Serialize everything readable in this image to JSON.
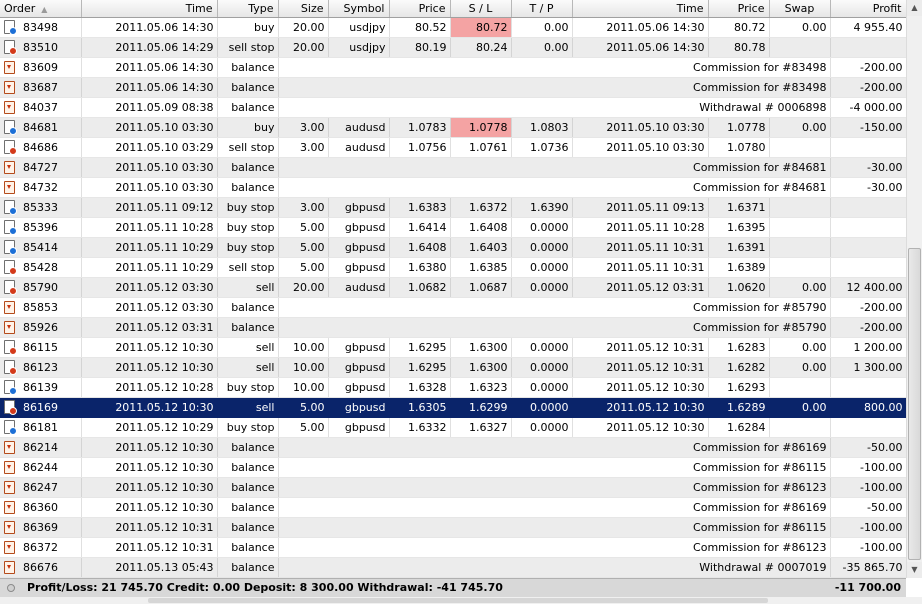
{
  "columns": {
    "order": "Order",
    "time": "Time",
    "type": "Type",
    "size": "Size",
    "symbol": "Symbol",
    "price": "Price",
    "sl": "S / L",
    "tp": "T / P",
    "close_time": "Time",
    "close_price": "Price",
    "swap": "Swap",
    "profit": "Profit"
  },
  "colors": {
    "selected_row": "#0a246a",
    "sl_highlight": "#f4a3a3",
    "buy_dot": "#1c6fd6",
    "sell_dot": "#d33a1a"
  },
  "rows": [
    {
      "order": "83498",
      "time": "2011.05.06 14:30",
      "type": "buy",
      "size": "20.00",
      "symbol": "usdjpy",
      "price": "80.52",
      "sl": "80.72",
      "tp": "0.00",
      "close_time": "2011.05.06 14:30",
      "close_price": "80.72",
      "swap": "0.00",
      "profit": "4 955.40",
      "icon": "buy-order-icon",
      "sl_hl": true
    },
    {
      "order": "83510",
      "time": "2011.05.06 14:29",
      "type": "sell stop",
      "size": "20.00",
      "symbol": "usdjpy",
      "price": "80.19",
      "sl": "80.24",
      "tp": "0.00",
      "close_time": "2011.05.06 14:30",
      "close_price": "80.78",
      "swap": "",
      "profit": "",
      "icon": "sell-order-icon"
    },
    {
      "order": "83609",
      "time": "2011.05.06 14:30",
      "type": "balance",
      "comment": "Commission for #83498",
      "profit": "-200.00",
      "icon": "balance-icon"
    },
    {
      "order": "83687",
      "time": "2011.05.06 14:30",
      "type": "balance",
      "comment": "Commission for #83498",
      "profit": "-200.00",
      "icon": "balance-icon"
    },
    {
      "order": "84037",
      "time": "2011.05.09 08:38",
      "type": "balance",
      "comment": "Withdrawal # 0006898",
      "profit": "-4 000.00",
      "icon": "balance-icon"
    },
    {
      "order": "84681",
      "time": "2011.05.10 03:30",
      "type": "buy",
      "size": "3.00",
      "symbol": "audusd",
      "price": "1.0783",
      "sl": "1.0778",
      "tp": "1.0803",
      "close_time": "2011.05.10 03:30",
      "close_price": "1.0778",
      "swap": "0.00",
      "profit": "-150.00",
      "icon": "buy-order-icon",
      "sl_hl": true
    },
    {
      "order": "84686",
      "time": "2011.05.10 03:29",
      "type": "sell stop",
      "size": "3.00",
      "symbol": "audusd",
      "price": "1.0756",
      "sl": "1.0761",
      "tp": "1.0736",
      "close_time": "2011.05.10 03:30",
      "close_price": "1.0780",
      "swap": "",
      "profit": "",
      "icon": "sell-order-icon"
    },
    {
      "order": "84727",
      "time": "2011.05.10 03:30",
      "type": "balance",
      "comment": "Commission for #84681",
      "profit": "-30.00",
      "icon": "balance-icon"
    },
    {
      "order": "84732",
      "time": "2011.05.10 03:30",
      "type": "balance",
      "comment": "Commission for #84681",
      "profit": "-30.00",
      "icon": "balance-icon"
    },
    {
      "order": "85333",
      "time": "2011.05.11 09:12",
      "type": "buy stop",
      "size": "3.00",
      "symbol": "gbpusd",
      "price": "1.6383",
      "sl": "1.6372",
      "tp": "1.6390",
      "close_time": "2011.05.11 09:13",
      "close_price": "1.6371",
      "swap": "",
      "profit": "",
      "icon": "buy-order-icon"
    },
    {
      "order": "85396",
      "time": "2011.05.11 10:28",
      "type": "buy stop",
      "size": "5.00",
      "symbol": "gbpusd",
      "price": "1.6414",
      "sl": "1.6408",
      "tp": "0.0000",
      "close_time": "2011.05.11 10:28",
      "close_price": "1.6395",
      "swap": "",
      "profit": "",
      "icon": "buy-order-icon"
    },
    {
      "order": "85414",
      "time": "2011.05.11 10:29",
      "type": "buy stop",
      "size": "5.00",
      "symbol": "gbpusd",
      "price": "1.6408",
      "sl": "1.6403",
      "tp": "0.0000",
      "close_time": "2011.05.11 10:31",
      "close_price": "1.6391",
      "swap": "",
      "profit": "",
      "icon": "buy-order-icon"
    },
    {
      "order": "85428",
      "time": "2011.05.11 10:29",
      "type": "sell stop",
      "size": "5.00",
      "symbol": "gbpusd",
      "price": "1.6380",
      "sl": "1.6385",
      "tp": "0.0000",
      "close_time": "2011.05.11 10:31",
      "close_price": "1.6389",
      "swap": "",
      "profit": "",
      "icon": "sell-order-icon"
    },
    {
      "order": "85790",
      "time": "2011.05.12 03:30",
      "type": "sell",
      "size": "20.00",
      "symbol": "audusd",
      "price": "1.0682",
      "sl": "1.0687",
      "tp": "0.0000",
      "close_time": "2011.05.12 03:31",
      "close_price": "1.0620",
      "swap": "0.00",
      "profit": "12 400.00",
      "icon": "sell-order-icon"
    },
    {
      "order": "85853",
      "time": "2011.05.12 03:30",
      "type": "balance",
      "comment": "Commission for #85790",
      "profit": "-200.00",
      "icon": "balance-icon"
    },
    {
      "order": "85926",
      "time": "2011.05.12 03:31",
      "type": "balance",
      "comment": "Commission for #85790",
      "profit": "-200.00",
      "icon": "balance-icon"
    },
    {
      "order": "86115",
      "time": "2011.05.12 10:30",
      "type": "sell",
      "size": "10.00",
      "symbol": "gbpusd",
      "price": "1.6295",
      "sl": "1.6300",
      "tp": "0.0000",
      "close_time": "2011.05.12 10:31",
      "close_price": "1.6283",
      "swap": "0.00",
      "profit": "1 200.00",
      "icon": "sell-order-icon"
    },
    {
      "order": "86123",
      "time": "2011.05.12 10:30",
      "type": "sell",
      "size": "10.00",
      "symbol": "gbpusd",
      "price": "1.6295",
      "sl": "1.6300",
      "tp": "0.0000",
      "close_time": "2011.05.12 10:31",
      "close_price": "1.6282",
      "swap": "0.00",
      "profit": "1 300.00",
      "icon": "sell-order-icon"
    },
    {
      "order": "86139",
      "time": "2011.05.12 10:28",
      "type": "buy stop",
      "size": "10.00",
      "symbol": "gbpusd",
      "price": "1.6328",
      "sl": "1.6323",
      "tp": "0.0000",
      "close_time": "2011.05.12 10:30",
      "close_price": "1.6293",
      "swap": "",
      "profit": "",
      "icon": "buy-order-icon"
    },
    {
      "order": "86169",
      "time": "2011.05.12 10:30",
      "type": "sell",
      "size": "5.00",
      "symbol": "gbpusd",
      "price": "1.6305",
      "sl": "1.6299",
      "tp": "0.0000",
      "close_time": "2011.05.12 10:30",
      "close_price": "1.6289",
      "swap": "0.00",
      "profit": "800.00",
      "icon": "sell-order-icon",
      "selected": true
    },
    {
      "order": "86181",
      "time": "2011.05.12 10:29",
      "type": "buy stop",
      "size": "5.00",
      "symbol": "gbpusd",
      "price": "1.6332",
      "sl": "1.6327",
      "tp": "0.0000",
      "close_time": "2011.05.12 10:30",
      "close_price": "1.6284",
      "swap": "",
      "profit": "",
      "icon": "buy-order-icon"
    },
    {
      "order": "86214",
      "time": "2011.05.12 10:30",
      "type": "balance",
      "comment": "Commission for #86169",
      "profit": "-50.00",
      "icon": "balance-icon"
    },
    {
      "order": "86244",
      "time": "2011.05.12 10:30",
      "type": "balance",
      "comment": "Commission for #86115",
      "profit": "-100.00",
      "icon": "balance-icon"
    },
    {
      "order": "86247",
      "time": "2011.05.12 10:30",
      "type": "balance",
      "comment": "Commission for #86123",
      "profit": "-100.00",
      "icon": "balance-icon"
    },
    {
      "order": "86360",
      "time": "2011.05.12 10:30",
      "type": "balance",
      "comment": "Commission for #86169",
      "profit": "-50.00",
      "icon": "balance-icon"
    },
    {
      "order": "86369",
      "time": "2011.05.12 10:31",
      "type": "balance",
      "comment": "Commission for #86115",
      "profit": "-100.00",
      "icon": "balance-icon"
    },
    {
      "order": "86372",
      "time": "2011.05.12 10:31",
      "type": "balance",
      "comment": "Commission for #86123",
      "profit": "-100.00",
      "icon": "balance-icon"
    },
    {
      "order": "86676",
      "time": "2011.05.13 05:43",
      "type": "balance",
      "comment": "Withdrawal # 0007019",
      "profit": "-35 865.70",
      "icon": "balance-icon"
    }
  ],
  "summary": {
    "text": "Profit/Loss: 21 745.70  Credit: 0.00  Deposit: 8 300.00  Withdrawal: -41 745.70",
    "total": "-11 700.00"
  }
}
